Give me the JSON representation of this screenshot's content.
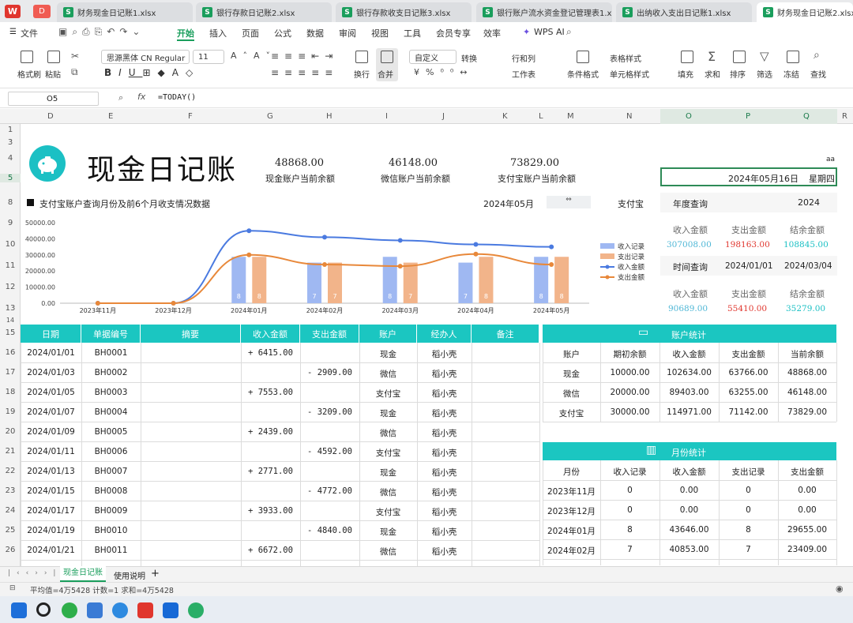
{
  "file_tabs": [
    {
      "label": "财务现金日记账1.xlsx"
    },
    {
      "label": "银行存款日记账2.xlsx"
    },
    {
      "label": "银行存款收支日记账3.xlsx"
    },
    {
      "label": "银行账户流水资金登记管理表1.xlsx"
    },
    {
      "label": "出纳收入支出日记账1.xlsx"
    },
    {
      "label": "财务现金日记账2.xlsx"
    }
  ],
  "menu": {
    "file": "文件",
    "items": [
      "开始",
      "插入",
      "页面",
      "公式",
      "数据",
      "审阅",
      "视图",
      "工具",
      "会员专享",
      "效率"
    ],
    "wps_ai": "WPS AI"
  },
  "ribbon": {
    "format_painter": "格式刷",
    "paste": "粘贴",
    "font_name": "思源黑体 CN Regular",
    "font_size": "11",
    "wrap": "换行",
    "merge": "合并",
    "number_format": "自定义",
    "convert": "转换",
    "row_col": "行和列",
    "worksheet": "工作表",
    "cond_format": "条件格式",
    "table_style": "表格样式",
    "cell_style": "单元格样式",
    "fill": "填充",
    "sum": "求和",
    "sort": "排序",
    "filter": "筛选",
    "freeze": "冻结",
    "find": "查找"
  },
  "formula_bar": {
    "cell": "O5",
    "fx": "fx",
    "formula": "=TODAY()"
  },
  "columns": [
    "D",
    "E",
    "F",
    "G",
    "H",
    "I",
    "J",
    "K",
    "L",
    "M",
    "N",
    "O",
    "P",
    "Q",
    "R"
  ],
  "rows": [
    "1",
    "3",
    "4",
    "5",
    "8",
    "9",
    "10",
    "11",
    "12",
    "13",
    "14",
    "15",
    "16",
    "17",
    "18",
    "19",
    "20",
    "21",
    "22",
    "23",
    "24",
    "25",
    "26"
  ],
  "title": "现金日记账",
  "balances": [
    {
      "value": "48868.00",
      "caption": "现金账户当前余额",
      "color": "#4fb7d6"
    },
    {
      "value": "46148.00",
      "caption": "微信账户当前余额",
      "color": "#8b7fc9"
    },
    {
      "value": "73829.00",
      "caption": "支付宝账户当前余额",
      "color": "#e0953d"
    }
  ],
  "date_box": {
    "date": "2024年05月16日",
    "weekday": "星期四",
    "aa": "aa"
  },
  "query_header": {
    "caption": "支付宝账户查询月份及前6个月收支情况数据",
    "month": "2024年05月",
    "account": "支付宝",
    "annual_label": "年度查询",
    "annual_year": "2024"
  },
  "annual_summary": {
    "headers": [
      "收入金额",
      "支出金额",
      "结余金额"
    ],
    "values": [
      "307008.00",
      "198163.00",
      "108845.00"
    ],
    "colors": [
      "#4fb7d6",
      "#e0362e",
      "#1bc0c4"
    ]
  },
  "time_query": {
    "label": "时间查询",
    "from": "2024/01/01",
    "to": "2024/03/04",
    "headers": [
      "收入金额",
      "支出金额",
      "结余金额"
    ],
    "values": [
      "90689.00",
      "55410.00",
      "35279.00"
    ],
    "colors": [
      "#4fb7d6",
      "#e0362e",
      "#1bc0c4"
    ]
  },
  "chart_data": {
    "type": "bar",
    "categories": [
      "2023年11月",
      "2023年12月",
      "2024年01月",
      "2024年02月",
      "2024年03月",
      "2024年04月",
      "2024年05月"
    ],
    "series": [
      {
        "name": "收入记录",
        "type": "bar",
        "values": [
          0,
          0,
          8,
          7,
          8,
          7,
          8
        ],
        "color": "#9fb8f2",
        "labels": [
          "",
          "",
          "8",
          "7",
          "8",
          "7",
          "8"
        ]
      },
      {
        "name": "支出记录",
        "type": "bar",
        "values": [
          0,
          0,
          8,
          7,
          7,
          8,
          8
        ],
        "color": "#f2b48a",
        "labels": [
          "",
          "",
          "8",
          "7",
          "7",
          "8",
          "8"
        ]
      },
      {
        "name": "收入金额",
        "type": "line",
        "values": [
          0,
          0,
          45000,
          41000,
          39000,
          36500,
          35000
        ],
        "color": "#4a7ae0"
      },
      {
        "name": "支出金额",
        "type": "line",
        "values": [
          0,
          0,
          30000,
          24000,
          23000,
          30500,
          24000
        ],
        "color": "#e8883a"
      }
    ],
    "y_ticks": [
      "0.00",
      "10000.00",
      "20000.00",
      "30000.00",
      "40000.00",
      "50000.00"
    ],
    "ylim": [
      0,
      50000
    ],
    "bar_scale_max": 10,
    "legend": "right"
  },
  "ledger": {
    "headers": [
      "日期",
      "单据编号",
      "摘要",
      "收入金额",
      "支出金额",
      "账户",
      "经办人",
      "备注"
    ],
    "rows": [
      {
        "date": "2024/01/01",
        "id": "BH0001",
        "income": "+ 6415.00",
        "expense": "",
        "account": "现金",
        "handler": "稻小壳"
      },
      {
        "date": "2024/01/03",
        "id": "BH0002",
        "income": "",
        "expense": "- 2909.00",
        "account": "微信",
        "handler": "稻小壳"
      },
      {
        "date": "2024/01/05",
        "id": "BH0003",
        "income": "+ 7553.00",
        "expense": "",
        "account": "支付宝",
        "handler": "稻小壳"
      },
      {
        "date": "2024/01/07",
        "id": "BH0004",
        "income": "",
        "expense": "- 3209.00",
        "account": "现金",
        "handler": "稻小壳"
      },
      {
        "date": "2024/01/09",
        "id": "BH0005",
        "income": "+ 2439.00",
        "expense": "",
        "account": "微信",
        "handler": "稻小壳"
      },
      {
        "date": "2024/01/11",
        "id": "BH0006",
        "income": "",
        "expense": "- 4592.00",
        "account": "支付宝",
        "handler": "稻小壳"
      },
      {
        "date": "2024/01/13",
        "id": "BH0007",
        "income": "+ 2771.00",
        "expense": "",
        "account": "现金",
        "handler": "稻小壳"
      },
      {
        "date": "2024/01/15",
        "id": "BH0008",
        "income": "",
        "expense": "- 4772.00",
        "account": "微信",
        "handler": "稻小壳"
      },
      {
        "date": "2024/01/17",
        "id": "BH0009",
        "income": "+ 3933.00",
        "expense": "",
        "account": "支付宝",
        "handler": "稻小壳"
      },
      {
        "date": "2024/01/19",
        "id": "BH0010",
        "income": "",
        "expense": "- 4840.00",
        "account": "现金",
        "handler": "稻小壳"
      },
      {
        "date": "2024/01/21",
        "id": "BH0011",
        "income": "+ 6672.00",
        "expense": "",
        "account": "微信",
        "handler": "稻小壳"
      }
    ]
  },
  "account_stats": {
    "title": "账户统计",
    "headers": [
      "账户",
      "期初余额",
      "收入金额",
      "支出金额",
      "当前余额"
    ],
    "rows": [
      [
        "现金",
        "10000.00",
        "102634.00",
        "63766.00",
        "48868.00"
      ],
      [
        "微信",
        "20000.00",
        "89403.00",
        "63255.00",
        "46148.00"
      ],
      [
        "支付宝",
        "30000.00",
        "114971.00",
        "71142.00",
        "73829.00"
      ]
    ]
  },
  "month_stats": {
    "title": "月份统计",
    "headers": [
      "月份",
      "收入记录",
      "收入金额",
      "支出记录",
      "支出金额"
    ],
    "rows": [
      [
        "2023年11月",
        "0",
        "0.00",
        "0",
        "0.00"
      ],
      [
        "2023年12月",
        "0",
        "0.00",
        "0",
        "0.00"
      ],
      [
        "2024年01月",
        "8",
        "43646.00",
        "8",
        "29655.00"
      ],
      [
        "2024年02月",
        "7",
        "40853.00",
        "7",
        "23409.00"
      ]
    ]
  },
  "sheet_tabs": {
    "active": "现金日记账",
    "other": "使用说明",
    "add": "+"
  },
  "status": {
    "text": "平均值=4万5428  计数=1  求和=4万5428"
  },
  "colors": {
    "accent": "#1a9e5c",
    "teal": "#1bc6c1"
  }
}
